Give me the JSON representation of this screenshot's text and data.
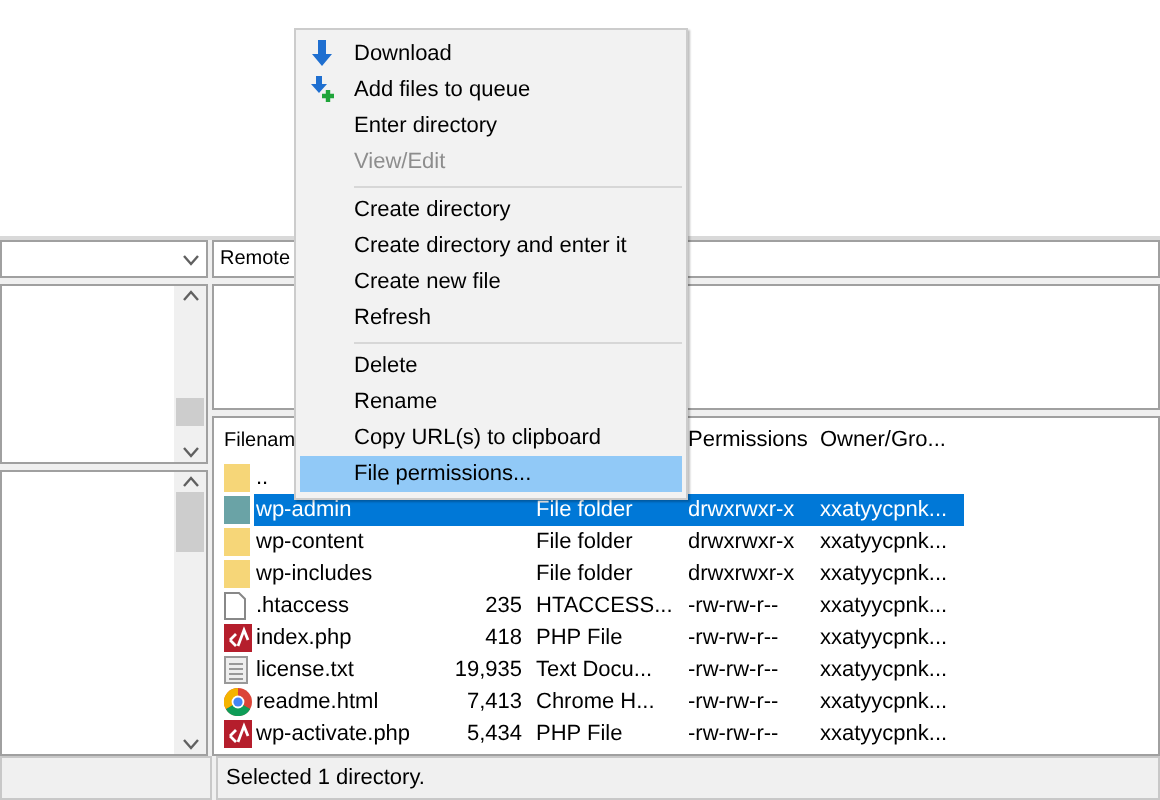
{
  "remote_site": {
    "label": "Remote",
    "file_list": {
      "columns": [
        "Filenam",
        "Permissions",
        "Owner/Gro..."
      ],
      "rows": [
        {
          "kind": "folder",
          "name": "..",
          "selected": false
        },
        {
          "kind": "folder",
          "name": "wp-admin",
          "type": "File folder",
          "permissions": "drwxrwxr-x",
          "owner": "xxatyycpnk...",
          "selected": true
        },
        {
          "kind": "folder",
          "name": "wp-content",
          "type": "File folder",
          "permissions": "drwxrwxr-x",
          "owner": "xxatyycpnk...",
          "selected": false
        },
        {
          "kind": "folder",
          "name": "wp-includes",
          "type": "File folder",
          "permissions": "drwxrwxr-x",
          "owner": "xxatyycpnk...",
          "selected": false
        },
        {
          "kind": "file",
          "name": ".htaccess",
          "size": "235",
          "type": "HTACCESS...",
          "permissions": "-rw-rw-r--",
          "owner": "xxatyycpnk...",
          "selected": false
        },
        {
          "kind": "php",
          "name": "index.php",
          "size": "418",
          "type": "PHP File",
          "permissions": "-rw-rw-r--",
          "owner": "xxatyycpnk...",
          "selected": false
        },
        {
          "kind": "text",
          "name": "license.txt",
          "size": "19,935",
          "type": "Text Docu...",
          "permissions": "-rw-rw-r--",
          "owner": "xxatyycpnk...",
          "selected": false
        },
        {
          "kind": "chrome",
          "name": "readme.html",
          "size": "7,413",
          "type": "Chrome H...",
          "permissions": "-rw-rw-r--",
          "owner": "xxatyycpnk...",
          "selected": false
        },
        {
          "kind": "php",
          "name": "wp-activate.php",
          "size": "5,434",
          "type": "PHP File",
          "permissions": "-rw-rw-r--",
          "owner": "xxatyycpnk...",
          "selected": false
        }
      ]
    },
    "status": "Selected 1 directory."
  },
  "context_menu": [
    {
      "kind": "download",
      "label": "Download",
      "disabled": false,
      "selected": false
    },
    {
      "kind": "queue",
      "label": "Add files to queue",
      "disabled": false,
      "selected": false
    },
    {
      "kind": "item",
      "label": "Enter directory",
      "disabled": false,
      "selected": false
    },
    {
      "kind": "item",
      "label": "View/Edit",
      "disabled": true,
      "selected": false
    },
    {
      "kind": "separator"
    },
    {
      "kind": "item",
      "label": "Create directory",
      "disabled": false,
      "selected": false
    },
    {
      "kind": "item",
      "label": "Create directory and enter it",
      "disabled": false,
      "selected": false
    },
    {
      "kind": "item",
      "label": "Create new file",
      "disabled": false,
      "selected": false
    },
    {
      "kind": "item",
      "label": "Refresh",
      "disabled": false,
      "selected": false
    },
    {
      "kind": "separator"
    },
    {
      "kind": "item",
      "label": "Delete",
      "disabled": false,
      "selected": false
    },
    {
      "kind": "item",
      "label": "Rename",
      "disabled": false,
      "selected": false
    },
    {
      "kind": "item",
      "label": "Copy URL(s) to clipboard",
      "disabled": false,
      "selected": false
    },
    {
      "kind": "item",
      "label": "File permissions...",
      "disabled": false,
      "selected": true
    }
  ]
}
